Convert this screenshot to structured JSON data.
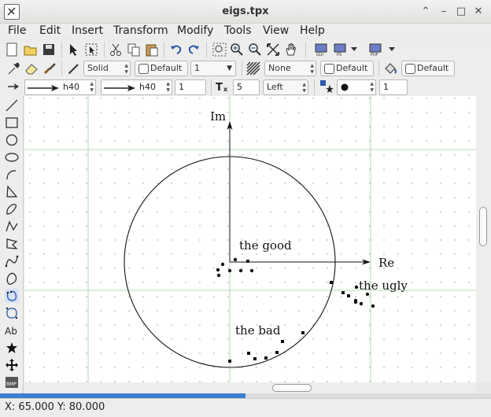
{
  "window": {
    "title": "eigs.tpx"
  },
  "menu": [
    "File",
    "Edit",
    "Insert",
    "Transform",
    "Modify",
    "Tools",
    "View",
    "Help"
  ],
  "toolbar2": {
    "line_style": "Solid",
    "line_color": "Default",
    "line_width": "1",
    "fill_style": "None",
    "fill_color": "Default",
    "bg_color": "Default"
  },
  "toolbar3": {
    "arrow_start": "h40",
    "arrow_end": "h40",
    "arrow_scale": "1",
    "text_size": "5",
    "text_align": "Left",
    "marker_size": "1"
  },
  "figure": {
    "axis_im": "Im",
    "axis_re": "Re",
    "label_good": "the good",
    "label_bad": "the bad",
    "label_ugly": "the ugly"
  },
  "progress": {
    "value": 0.5
  },
  "status": {
    "coords": "X: 65.000 Y: 80.000"
  }
}
